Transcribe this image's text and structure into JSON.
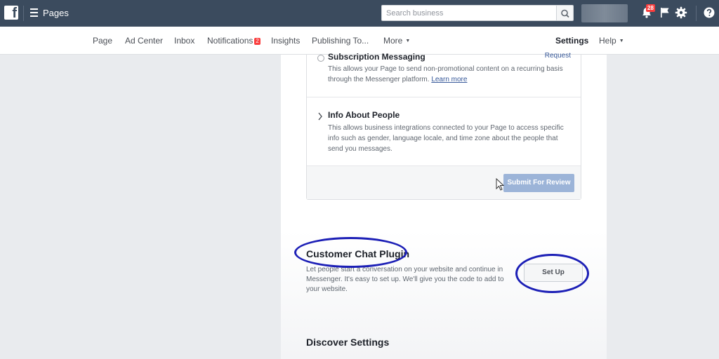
{
  "topbar": {
    "logo_letter": "f",
    "app_title": "Pages",
    "search": {
      "placeholder": "Search business",
      "value": ""
    },
    "notifications_count": "28"
  },
  "nav": {
    "items": [
      {
        "label": "Page",
        "active": false
      },
      {
        "label": "Ad Center",
        "active": false
      },
      {
        "label": "Inbox",
        "active": false
      },
      {
        "label": "Notifications",
        "badge": "2",
        "active": false
      },
      {
        "label": "Insights",
        "active": false
      },
      {
        "label": "Publishing To...",
        "active": false
      },
      {
        "label": "More",
        "caret": "▼",
        "active": false
      },
      {
        "label": "Settings",
        "active": true
      },
      {
        "label": "Help",
        "caret": "▼",
        "active": false
      }
    ]
  },
  "permissions_card": {
    "subscription": {
      "title": "Subscription Messaging",
      "desc": "This allows your Page to send non-promotional content on a recurring basis through the Messenger platform.",
      "link": "Learn more",
      "action": "Request"
    },
    "info_about_people": {
      "title": "Info About People",
      "desc": "This allows business integrations connected to your Page to access specific info such as gender, language locale, and time zone about the people that send you messages."
    },
    "submit_label": "Submit For Review"
  },
  "customer_chat": {
    "title": "Customer Chat Plugin",
    "desc": "Let people start a conversation on your website and continue in Messenger. It's easy to set up. We'll give you the code to add to your website.",
    "button": "Set Up"
  },
  "discover": {
    "title": "Discover Settings"
  },
  "colors": {
    "topbar": "#3b4b5e",
    "annotation": "#1c1fb6",
    "link": "#365899",
    "badge": "#fa3e3e"
  }
}
